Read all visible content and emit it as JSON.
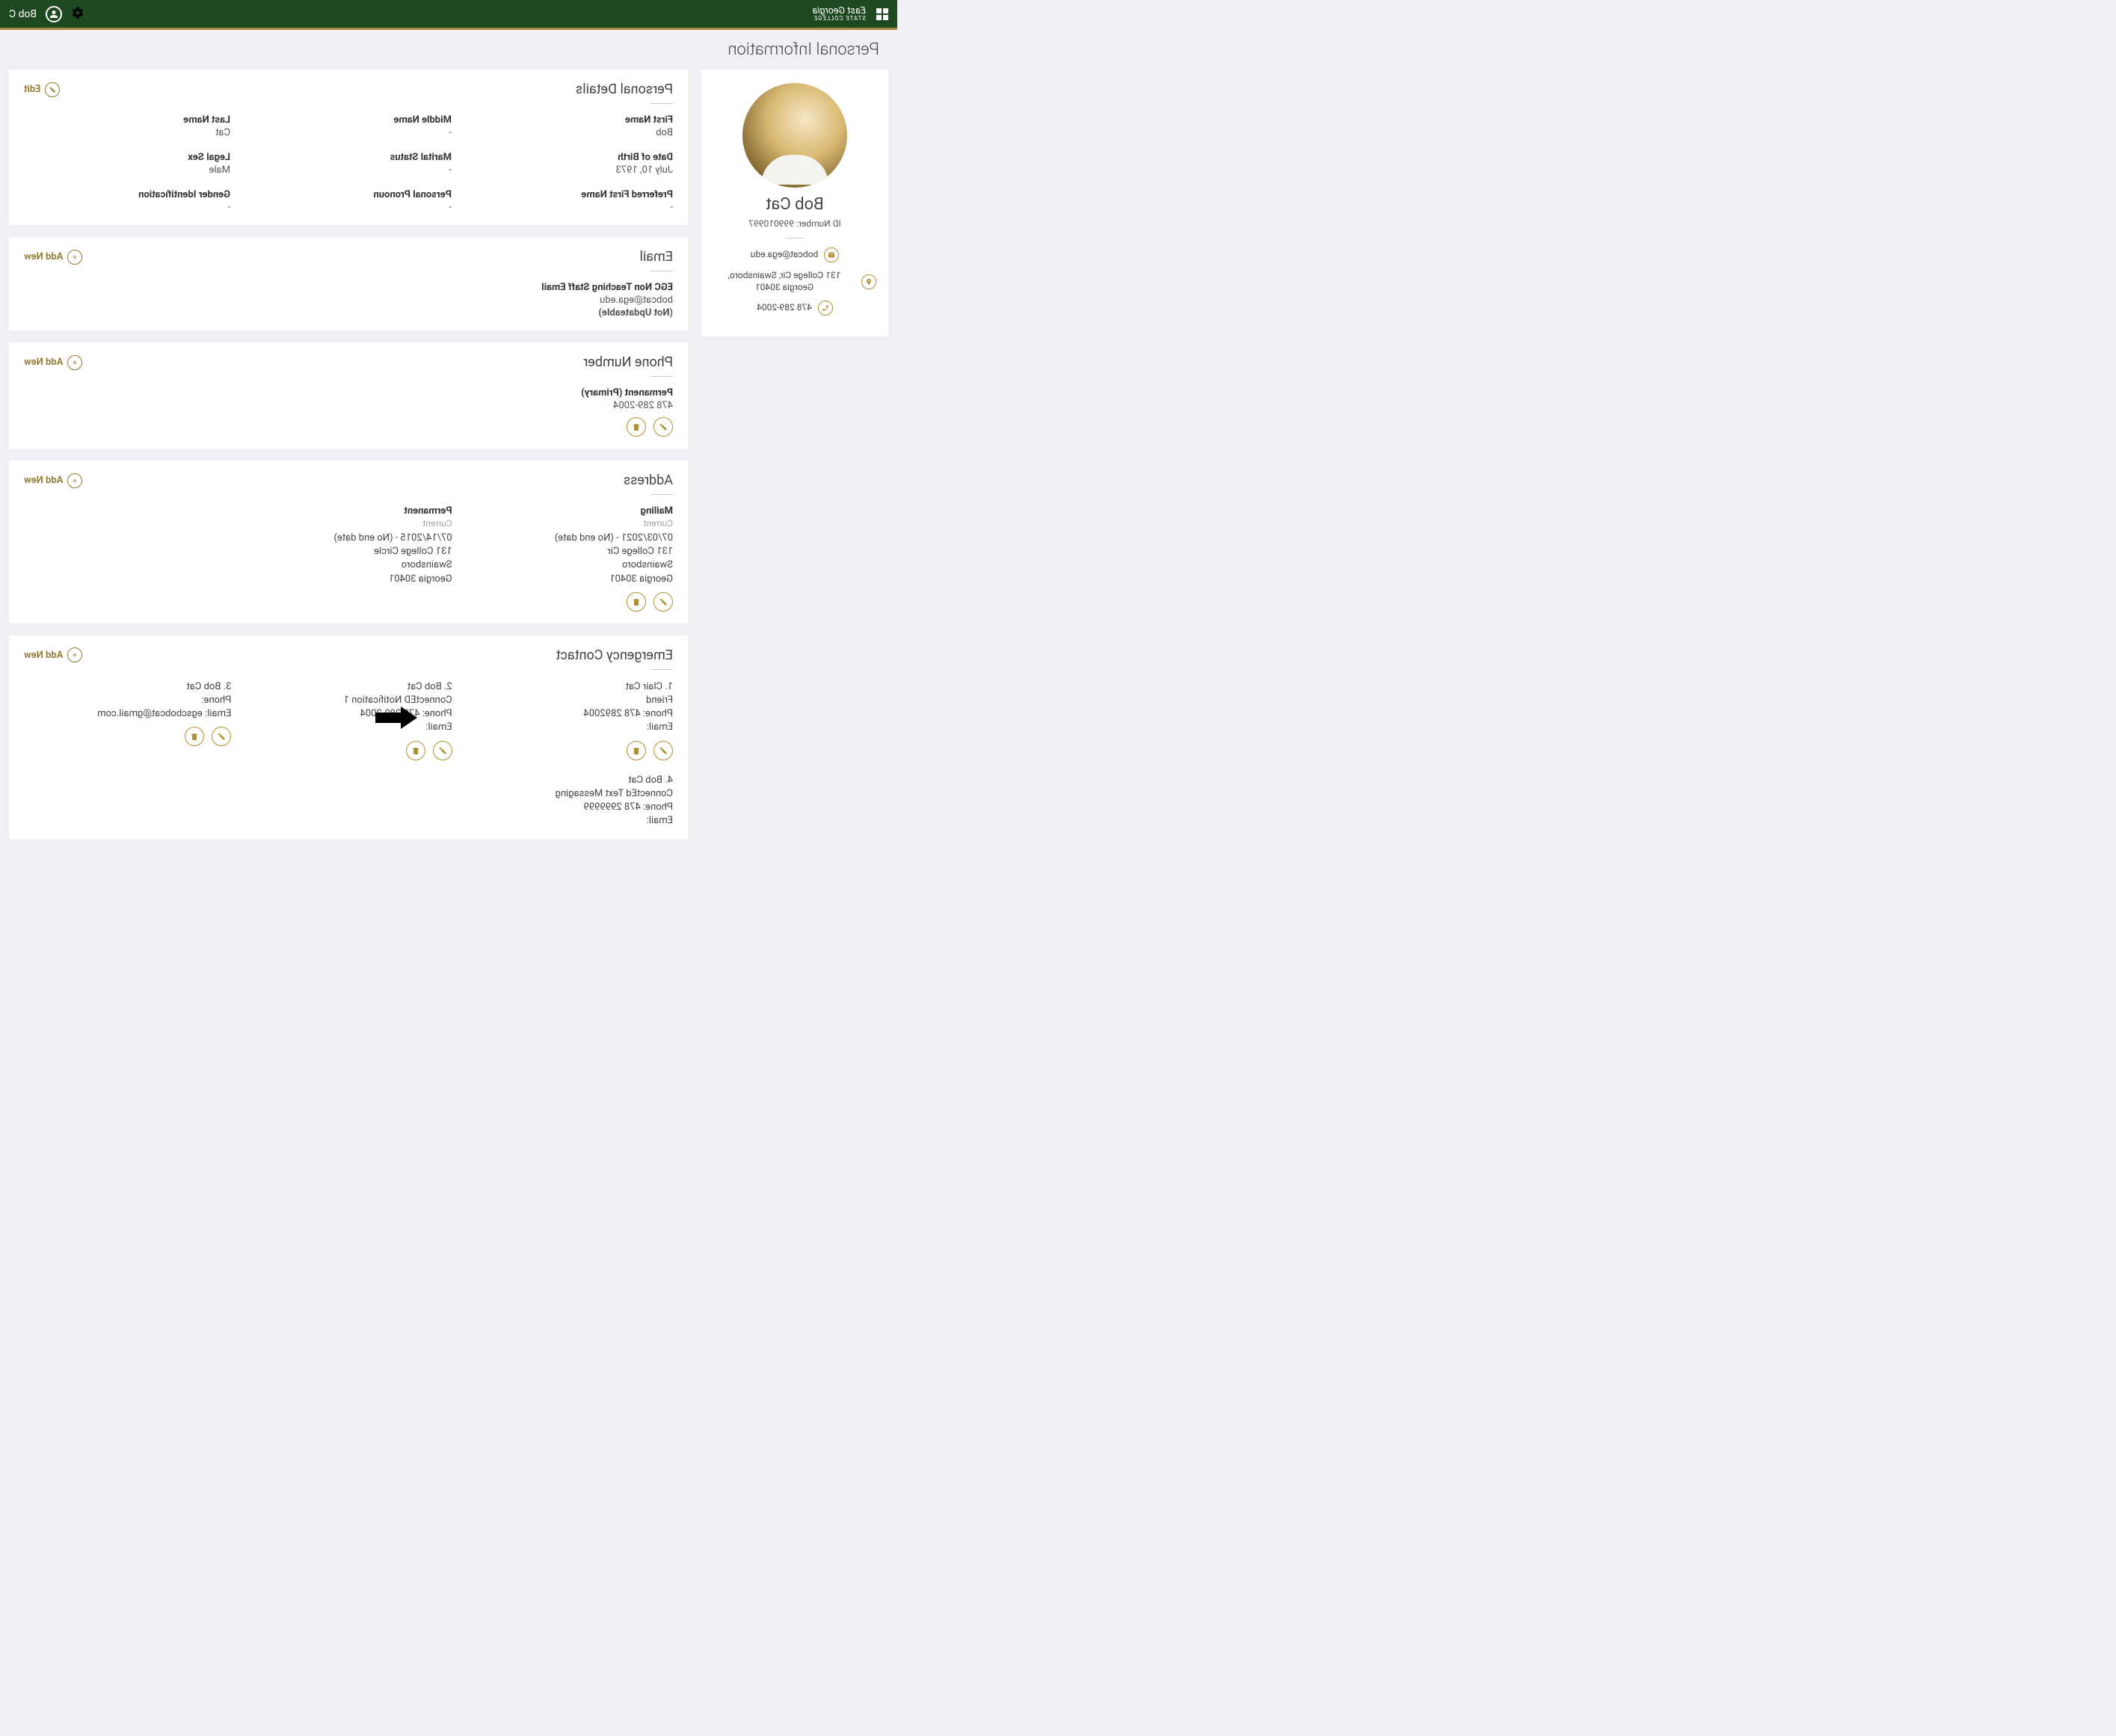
{
  "header": {
    "logo_top": "East Georgia",
    "logo_bottom": "STATE COLLEGE",
    "user_display": "Bob C"
  },
  "page_title": "Personal Information",
  "sidebar": {
    "name": "Bob Cat",
    "id_label": "ID Number: 999010997",
    "email": "bobcat@ega.edu",
    "address": "131 College Cir, Swainsboro, Georgia 30401",
    "phone": "478 289-2004"
  },
  "personal_details": {
    "title": "Personal Details",
    "edit_label": "Edit",
    "fields": {
      "first_name_label": "First Name",
      "first_name_value": "Bob",
      "middle_name_label": "Middle Name",
      "middle_name_value": "-",
      "last_name_label": "Last Name",
      "last_name_value": "Cat",
      "dob_label": "Date of Birth",
      "dob_value": "July 10, 1973",
      "marital_label": "Marital Status",
      "marital_value": "-",
      "legal_sex_label": "Legal Sex",
      "legal_sex_value": "Male",
      "pref_first_label": "Preferred First Name",
      "pref_first_value": "-",
      "pronoun_label": "Personal Pronoun",
      "pronoun_value": "-",
      "gender_id_label": "Gender Identification",
      "gender_id_value": "-"
    }
  },
  "email_section": {
    "title": "Email",
    "add_label": "Add New",
    "type_label": "EGC Non Teaching Staff Email",
    "email_value": "bobcat@ega.edu",
    "note": "(Not Updateable)"
  },
  "phone_section": {
    "title": "Phone Number",
    "add_label": "Add New",
    "type_label": "Permanent (Primary)",
    "phone_value": "478 289-2004"
  },
  "address_section": {
    "title": "Address",
    "add_label": "Add New",
    "addresses": [
      {
        "type": "Mailing",
        "status": "Current",
        "range": "07/03/2021 - (No end date)",
        "line1": "131 College Cir",
        "line2": "Swainsboro",
        "line3": "Georgia 30401"
      },
      {
        "type": "Permanent",
        "status": "Current",
        "range": "07/14/2015 - (No end date)",
        "line1": "131 College Circle",
        "line2": "Swainsboro",
        "line3": "Georgia 30401"
      }
    ]
  },
  "emergency_section": {
    "title": "Emergency Contact",
    "add_label": "Add New",
    "contacts": [
      {
        "name": "1. Clair Cat",
        "relation": "Friend",
        "phone": "Phone: 478 2892004",
        "email": "Email:"
      },
      {
        "name": "2. Bob Cat",
        "relation": "ConnectED Notification 1",
        "phone": "Phone: 478 289-2004",
        "email": "Email:"
      },
      {
        "name": "3. Bob Cat",
        "relation": "",
        "phone": "Phone:",
        "email": "Email: egscbobcat@gmail.com"
      },
      {
        "name": "4. Bob Cat",
        "relation": "ConnectEd Text Messaging",
        "phone": "Phone: 478 2999999",
        "email": "Email:"
      }
    ]
  }
}
